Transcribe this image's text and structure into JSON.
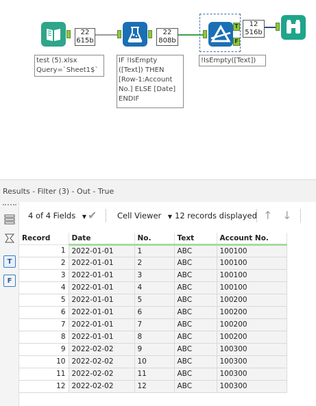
{
  "workflow": {
    "input": {
      "count": "22",
      "size": "615b",
      "annotation_line1": "test (5).xlsx",
      "annotation_line2": "Query=`Sheet1$`"
    },
    "formula": {
      "count": "22",
      "size": "808b",
      "annotation_lines": [
        "IF !IsEmpty",
        "([Text]) THEN",
        "[Row-1:Account",
        "No.] ELSE [Date]",
        "ENDIF"
      ]
    },
    "filter": {
      "count": "12",
      "size": "516b",
      "annotation": "!IsEmpty([Text])",
      "true_anchor": "T",
      "false_anchor": "F"
    },
    "colors": {
      "input_tool": "#2fa58a",
      "formula_tool": "#1b6fb5",
      "filter_tool": "#1b6fb5",
      "browse_tool": "#1fa58b",
      "anchor": "#8dc63f"
    }
  },
  "results": {
    "header": "Results - Filter (3) - Out - True",
    "toolbar": {
      "fields": "4 of 4 Fields",
      "cell_viewer": "Cell Viewer",
      "records_displayed": "12 records displayed"
    },
    "rail_tabs": {
      "true_tab": "T",
      "false_tab": "F"
    },
    "columns": [
      "Record",
      "Date",
      "No.",
      "Text",
      "Account No."
    ],
    "rows": [
      [
        "1",
        "2022-01-01",
        "1",
        "ABC",
        "100100"
      ],
      [
        "2",
        "2022-01-01",
        "2",
        "ABC",
        "100100"
      ],
      [
        "3",
        "2022-01-01",
        "3",
        "ABC",
        "100100"
      ],
      [
        "4",
        "2022-01-01",
        "4",
        "ABC",
        "100100"
      ],
      [
        "5",
        "2022-01-01",
        "5",
        "ABC",
        "100200"
      ],
      [
        "6",
        "2022-01-01",
        "6",
        "ABC",
        "100200"
      ],
      [
        "7",
        "2022-01-01",
        "7",
        "ABC",
        "100200"
      ],
      [
        "8",
        "2022-01-01",
        "8",
        "ABC",
        "100200"
      ],
      [
        "9",
        "2022-02-02",
        "9",
        "ABC",
        "100300"
      ],
      [
        "10",
        "2022-02-02",
        "10",
        "ABC",
        "100300"
      ],
      [
        "11",
        "2022-02-02",
        "11",
        "ABC",
        "100300"
      ],
      [
        "12",
        "2022-02-02",
        "12",
        "ABC",
        "100300"
      ]
    ]
  }
}
